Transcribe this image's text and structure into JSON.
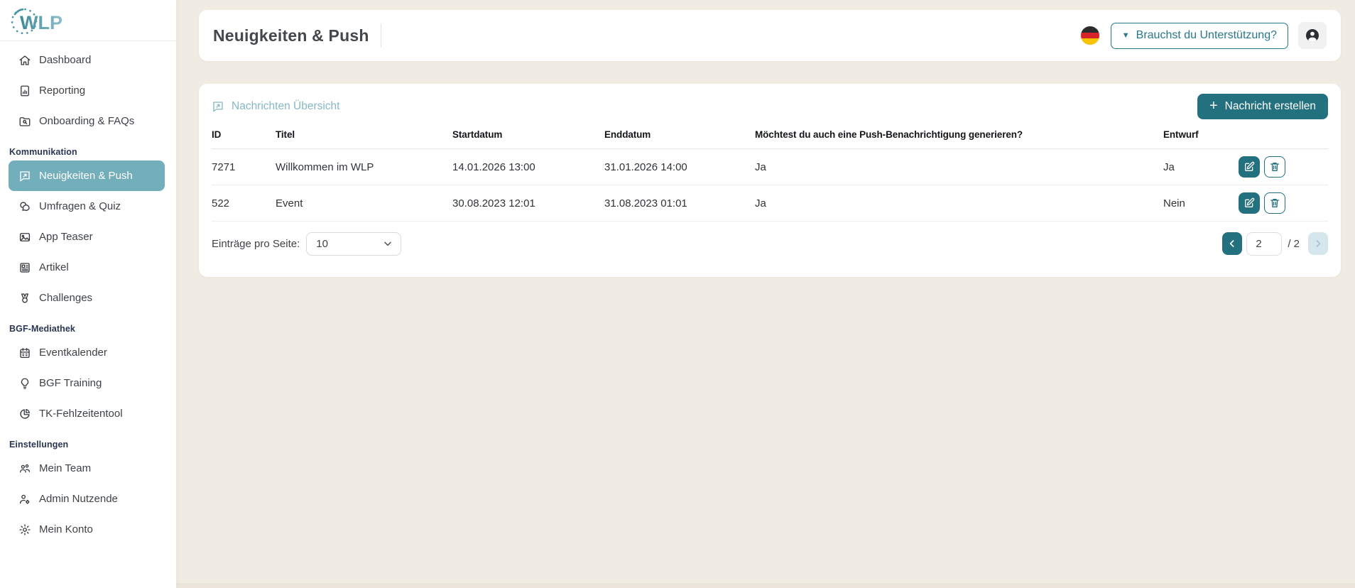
{
  "theme": {
    "page-bg": "#f1ece3",
    "teal-dark": "#23707f",
    "teal-mid": "#73aebb",
    "teal-light": "#85b9c5",
    "flag-black": "#2b2b2b",
    "flag-red": "#d8232a",
    "flag-gold": "#f8c300"
  },
  "sidebar": {
    "logo": "WLP",
    "top_items": [
      {
        "label": "Dashboard"
      },
      {
        "label": "Reporting"
      },
      {
        "label": "Onboarding & FAQs"
      }
    ],
    "sections": [
      {
        "title": "Kommunikation",
        "items": [
          {
            "label": "Neuigkeiten & Push"
          },
          {
            "label": "Umfragen & Quiz"
          },
          {
            "label": "App Teaser"
          },
          {
            "label": "Artikel"
          },
          {
            "label": "Challenges"
          }
        ]
      },
      {
        "title": "BGF-Mediathek",
        "items": [
          {
            "label": "Eventkalender"
          },
          {
            "label": "BGF Training"
          },
          {
            "label": "TK-Fehlzeitentool"
          }
        ]
      },
      {
        "title": "Einstellungen",
        "items": [
          {
            "label": "Mein Team"
          },
          {
            "label": "Admin Nutzende"
          },
          {
            "label": "Mein Konto"
          }
        ]
      }
    ]
  },
  "header": {
    "title": "Neuigkeiten & Push",
    "support_button": "Brauchst du Unterstützung?"
  },
  "content": {
    "overview_link": "Nachrichten Übersicht",
    "create_button": "Nachricht erstellen",
    "table": {
      "columns": [
        "ID",
        "Titel",
        "Startdatum",
        "Enddatum",
        "Möchtest du auch eine Push-Benachrichtigung generieren?",
        "Entwurf"
      ],
      "rows": [
        {
          "id": "7271",
          "titel": "Willkommen im WLP",
          "startdatum": "14.01.2026 13:00",
          "enddatum": "31.01.2026 14:00",
          "push": "Ja",
          "entwurf": "Ja"
        },
        {
          "id": "522",
          "titel": "Event",
          "startdatum": "30.08.2023 12:01",
          "enddatum": "31.08.2023 01:01",
          "push": "Ja",
          "entwurf": "Nein"
        }
      ]
    },
    "pagination": {
      "per_page_label": "Einträge pro Seite:",
      "per_page_value": "10",
      "page": "2",
      "total": "/ 2"
    }
  }
}
